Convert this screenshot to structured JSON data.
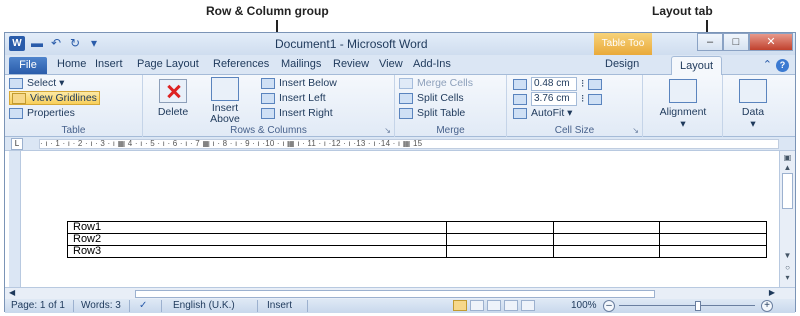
{
  "annotations": {
    "row_column_group": "Row & Column group",
    "layout_tab": "Layout tab"
  },
  "titlebar": {
    "app_icon": "W",
    "document_title": "Document1  -  Microsoft Word",
    "context_tab": "Table Too",
    "qat_icons": [
      "save-icon",
      "undo-icon",
      "redo-icon",
      "customize-icon"
    ]
  },
  "tabs": [
    "File",
    "Home",
    "Insert",
    "Page Layout",
    "References",
    "Mailings",
    "Review",
    "View",
    "Add-Ins",
    "Design",
    "Layout"
  ],
  "ribbon": {
    "table": {
      "select": "Select ▾",
      "view_gridlines": "View Gridlines",
      "properties": "Properties",
      "label": "Table"
    },
    "rows_columns": {
      "delete": "Delete",
      "insert_above_1": "Insert",
      "insert_above_2": "Above",
      "insert_below": "Insert Below",
      "insert_left": "Insert Left",
      "insert_right": "Insert Right",
      "label": "Rows & Columns"
    },
    "merge": {
      "merge_cells": "Merge Cells",
      "split_cells": "Split Cells",
      "split_table": "Split Table",
      "label": "Merge"
    },
    "cell_size": {
      "height": "0.48 cm",
      "width": "3.76 cm",
      "autofit": "AutoFit ▾",
      "label": "Cell Size"
    },
    "alignment": "Alignment",
    "data": "Data"
  },
  "ruler_text": "· ı · 1 · ı · 2 · ı · 3 · ı ▦ 4 · ı · 5 · ı · 6 · ı · 7 ▦ ı · 8 · ı · 9 · ı ·10 · ı ▦ ı · 11 · ı ·12 · ı ·13 · ı ·14 · ı ▦ 15",
  "table_rows": [
    [
      "Row1",
      "",
      "",
      ""
    ],
    [
      "Row2",
      "",
      "",
      ""
    ],
    [
      "Row3",
      "",
      "",
      ""
    ]
  ],
  "status": {
    "page": "Page: 1 of 1",
    "words": "Words: 3",
    "language": "English (U.K.)",
    "mode": "Insert",
    "zoom": "100%"
  }
}
